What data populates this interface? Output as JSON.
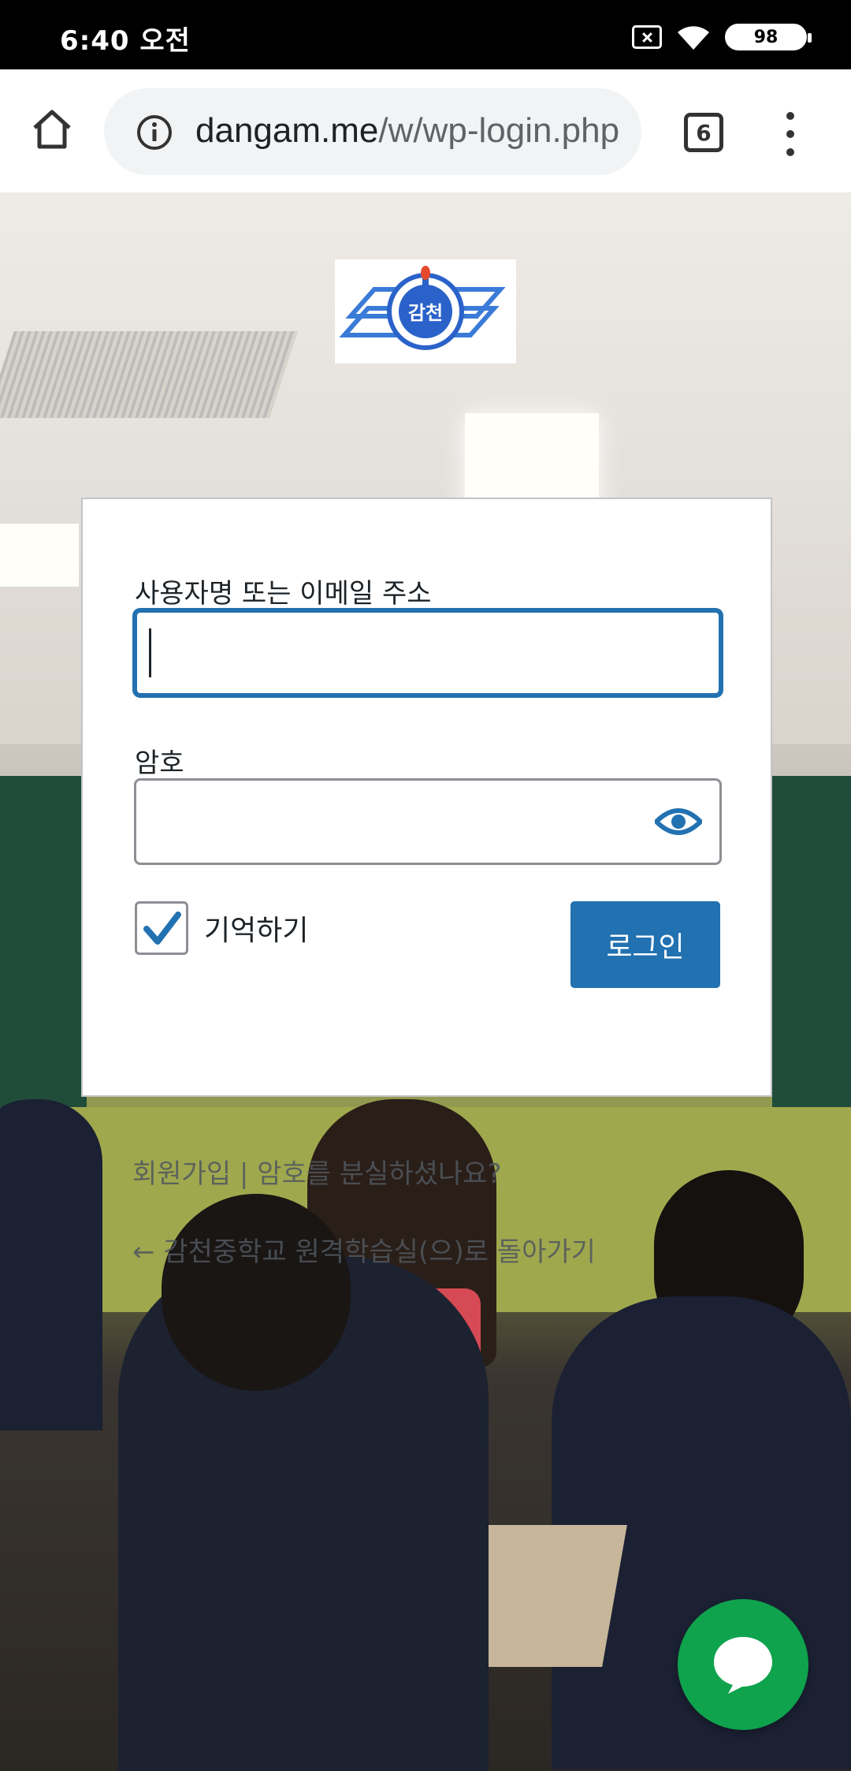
{
  "status_bar": {
    "time": "6:40 오전",
    "battery": "98",
    "icons": [
      "no-sim-icon",
      "wifi-icon",
      "battery-icon"
    ]
  },
  "browser": {
    "url_host": "dangam.me",
    "url_path": "/w/wp-login.php",
    "tab_count": "6",
    "icons": [
      "home-icon",
      "info-icon",
      "tabs-icon",
      "more-vert-icon"
    ]
  },
  "logo": {
    "text": "감천"
  },
  "login": {
    "username_label": "사용자명 또는 이메일 주소",
    "username_value": "",
    "password_label": "암호",
    "password_value": "",
    "remember_label": "기억하기",
    "remember_checked": true,
    "submit_label": "로그인"
  },
  "links": {
    "register": "회원가입",
    "separator": "|",
    "lost_password": "암호를 분실하셨나요?",
    "back_to_site": "← 감천중학교 원격학습실(으)로 돌아가기"
  },
  "colors": {
    "accent": "#2271b1",
    "chat_button": "#0fa34d"
  }
}
